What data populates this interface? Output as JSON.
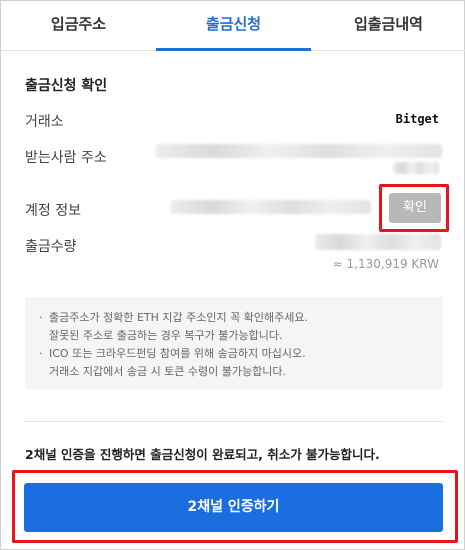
{
  "tabs": [
    {
      "label": "입금주소",
      "active": false
    },
    {
      "label": "출금신청",
      "active": true
    },
    {
      "label": "입출금내역",
      "active": false
    }
  ],
  "section_title": "출금신청 확인",
  "fields": {
    "exchange": {
      "label": "거래소",
      "value": "Bitget"
    },
    "recipient_address": {
      "label": "받는사람 주소"
    },
    "account_info": {
      "label": "계정 정보",
      "button_label": "확인"
    },
    "withdraw_amount": {
      "label": "출금수량",
      "krw_estimate": "≈ 1,130,919 KRW"
    }
  },
  "notice": {
    "items": [
      {
        "bullet": "·",
        "lines": [
          "출금주소가 정확한 ETH 지갑 주소인지 꼭 확인해주세요.",
          "잘못된 주소로 출금하는 경우 복구가 불가능합니다."
        ]
      },
      {
        "bullet": "·",
        "lines": [
          "ICO 또는 크라우드펀딩 참여를 위해 송금하지 마십시오.",
          "거래소 지갑에서 송금 시 토큰 수령이 불가능합니다."
        ]
      }
    ]
  },
  "warning_text": "2채널 인증을 진행하면 출금신청이 완료되고, 취소가 불가능합니다.",
  "auth_button_label": "2채널 인증하기",
  "colors": {
    "accent": "#1a6ee0",
    "highlight": "#e8141b",
    "tab_active": "#1f6fd6"
  }
}
